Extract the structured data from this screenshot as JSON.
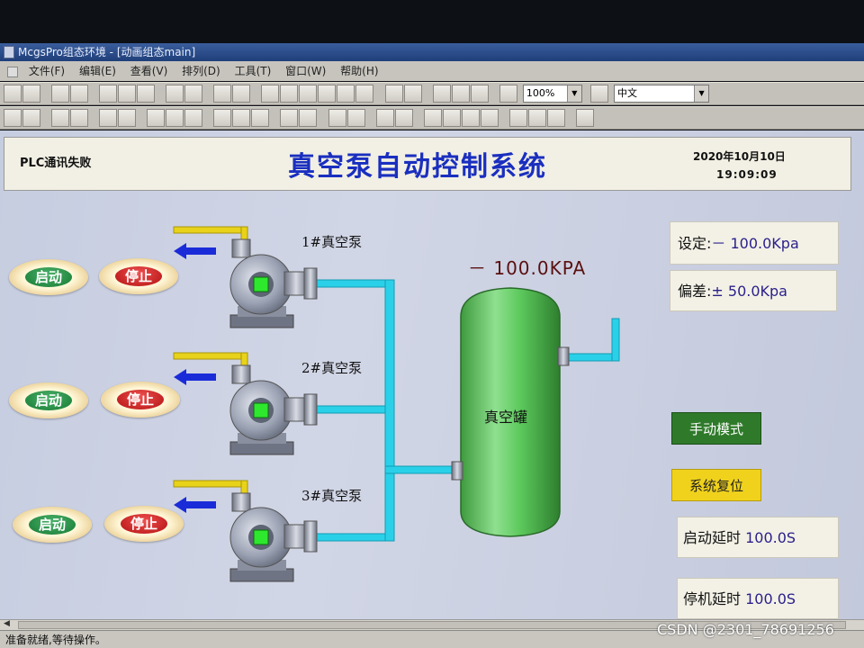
{
  "window": {
    "title": "McgsPro组态环境 - [动画组态main]"
  },
  "menubar": {
    "items": [
      "文件(F)",
      "编辑(E)",
      "查看(V)",
      "排列(D)",
      "工具(T)",
      "窗口(W)",
      "帮助(H)"
    ]
  },
  "toolbar": {
    "zoom_value": "100%",
    "language_value": "中文"
  },
  "header": {
    "plc_status": "PLC通讯失败",
    "title": "真空泵自动控制系统",
    "date": "2020年10月10日",
    "time": "19:09:09"
  },
  "pumps": [
    {
      "name": "1#真空泵",
      "start_label": "启动",
      "stop_label": "停止"
    },
    {
      "name": "2#真空泵",
      "start_label": "启动",
      "stop_label": "停止"
    },
    {
      "name": "3#真空泵",
      "start_label": "启动",
      "stop_label": "停止"
    }
  ],
  "tank": {
    "label": "真空罐",
    "pressure": "－ 100.0KPA"
  },
  "settings": {
    "setpoint_label": "设定:",
    "setpoint_value": "－ 100.0Kpa",
    "deviation_label": "偏差:",
    "deviation_value": "± 50.0Kpa",
    "manual_mode_label": "手动模式",
    "reset_label": "系统复位",
    "start_delay_label": "启动延时",
    "start_delay_value": "100.0S",
    "stop_delay_label": "停机延时",
    "stop_delay_value": "100.0S"
  },
  "statusbar": {
    "text": "准备就绪,等待操作。"
  },
  "watermark": "CSDN @2301_78691256",
  "colors": {
    "title_blue": "#1a2fbf",
    "pipe_cyan": "#2ad0e8",
    "inlet_yellow": "#e8d21a",
    "tank_green": "#5cc95c",
    "start_green": "#157a32",
    "stop_red": "#b21010"
  },
  "icons": [
    "app-icon",
    "toolbar-tool-icons",
    "arrow-left-icon",
    "pump-icon",
    "tank-icon"
  ]
}
